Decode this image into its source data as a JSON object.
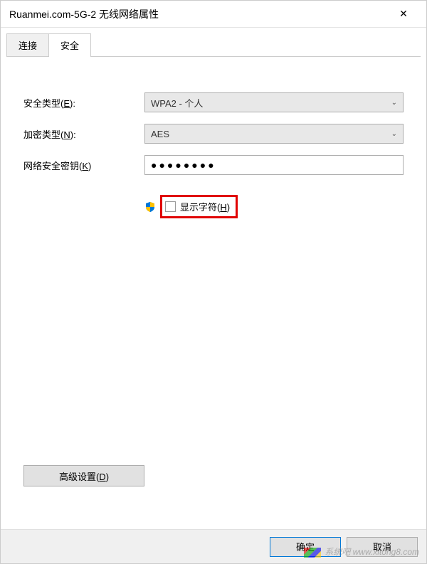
{
  "window": {
    "title": "Ruanmei.com-5G-2 无线网络属性",
    "close": "✕"
  },
  "tabs": {
    "connect": "连接",
    "security": "安全"
  },
  "form": {
    "securityTypeLabel": "安全类型(E):",
    "securityTypeValue": "WPA2 - 个人",
    "encryptionLabel": "加密类型(N):",
    "encryptionValue": "AES",
    "keyLabel": "网络安全密钥(K)",
    "keyValue": "●●●●●●●●",
    "showCharsLabel": "显示字符(H)",
    "advancedBtn": "高级设置(D)"
  },
  "footer": {
    "ok": "确定",
    "cancel": "取消",
    "watermark": "系统吧 www.xitong8.com"
  }
}
